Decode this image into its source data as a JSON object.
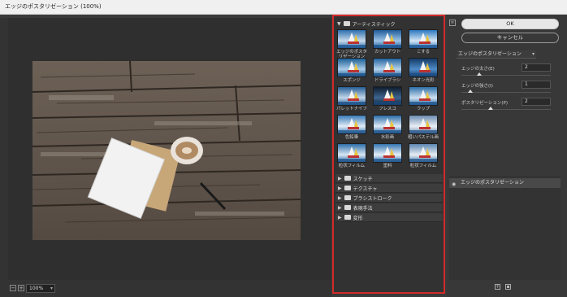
{
  "window": {
    "title": "エッジのポスタリゼーション (100%)"
  },
  "preview": {
    "zoom": "100%",
    "zoom_minus": "−",
    "zoom_plus": "+"
  },
  "filter_gallery": {
    "open_category": "アーティスティック",
    "thumbnails": [
      "エッジのポスタリゼーション",
      "カットアウト",
      "こする",
      "スポンジ",
      "ドライブラシ",
      "ネオン光彩",
      "パレットナイフ",
      "フレスコ",
      "ラップ",
      "色鉛筆",
      "水彩画",
      "粗いパステル画",
      "粒状フィルム",
      "塗料",
      "粒状フィルム"
    ],
    "categories": [
      "スケッチ",
      "テクスチャ",
      "ブラシストローク",
      "表現手法",
      "変形"
    ]
  },
  "buttons": {
    "ok": "OK",
    "cancel": "キャンセル"
  },
  "settings": {
    "filter_name": "エッジのポスタリゼーション",
    "params": [
      {
        "label": "エッジの太さ(E)",
        "value": "2",
        "level": 0.2
      },
      {
        "label": "エッジの強さ(I)",
        "value": "1",
        "level": 0.1
      },
      {
        "label": "ポスタリゼーション(P)",
        "value": "2",
        "level": 0.33
      }
    ]
  },
  "layers": {
    "active": "エッジのポスタリゼーション"
  },
  "colors": {
    "highlight": "#d42a2a",
    "panel": "#323232",
    "ok_button": "#e6e6e6"
  }
}
